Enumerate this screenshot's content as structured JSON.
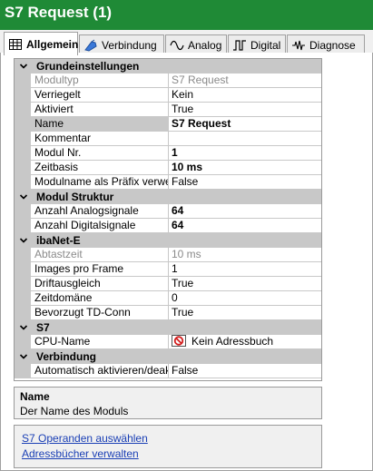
{
  "window": {
    "title": "S7 Request (1)"
  },
  "tabs": [
    {
      "label": "Allgemein",
      "icon": "grid-icon",
      "active": true
    },
    {
      "label": "Verbindung",
      "icon": "connection-icon"
    },
    {
      "label": "Analog",
      "icon": "analog-wave-icon"
    },
    {
      "label": "Digital",
      "icon": "digital-signal-icon"
    },
    {
      "label": "Diagnose",
      "icon": "diagnose-icon"
    }
  ],
  "properties": {
    "grundeinstellungen": {
      "title": "Grundeinstellungen",
      "modultyp": {
        "label": "Modultyp",
        "value": "S7 Request"
      },
      "verriegelt": {
        "label": "Verriegelt",
        "value": "Kein"
      },
      "aktiviert": {
        "label": "Aktiviert",
        "value": "True"
      },
      "name": {
        "label": "Name",
        "value": "S7 Request"
      },
      "kommentar": {
        "label": "Kommentar",
        "value": ""
      },
      "modul_nr": {
        "label": "Modul Nr.",
        "value": "1"
      },
      "zeitbasis": {
        "label": "Zeitbasis",
        "value": "10 ms"
      },
      "modulname_praefix": {
        "label": "Modulname als Präfix verwer",
        "value": "False"
      }
    },
    "modul_struktur": {
      "title": "Modul Struktur",
      "analogsignale": {
        "label": "Anzahl Analogsignale",
        "value": "64"
      },
      "digitalsignale": {
        "label": "Anzahl Digitalsignale",
        "value": "64"
      }
    },
    "ibanet_e": {
      "title": "ibaNet-E",
      "abtastzeit": {
        "label": "Abtastzeit",
        "value": "10 ms"
      },
      "images_pro_frame": {
        "label": "Images pro Frame",
        "value": "1"
      },
      "driftausgleich": {
        "label": "Driftausgleich",
        "value": "True"
      },
      "zeitdomaene": {
        "label": "Zeitdomäne",
        "value": "0"
      },
      "bevorzugt_td_conn": {
        "label": "Bevorzugt TD-Conn",
        "value": "True"
      }
    },
    "s7": {
      "title": "S7",
      "cpu_name": {
        "label": "CPU-Name",
        "value": "Kein Adressbuch",
        "icon": "no-address-book-icon"
      }
    },
    "verbindung": {
      "title": "Verbindung",
      "auto_aktivieren": {
        "label": "Automatisch aktivieren/deakt",
        "value": "False"
      }
    }
  },
  "description": {
    "title": "Name",
    "text": "Der Name des Moduls"
  },
  "links": {
    "s7_operanden": "S7 Operanden auswählen",
    "adressbuecher": "Adressbücher verwalten"
  },
  "colors": {
    "titlebar": "#1f8a36",
    "category_bg": "#c8c8c8",
    "link": "#1a3fb5"
  }
}
